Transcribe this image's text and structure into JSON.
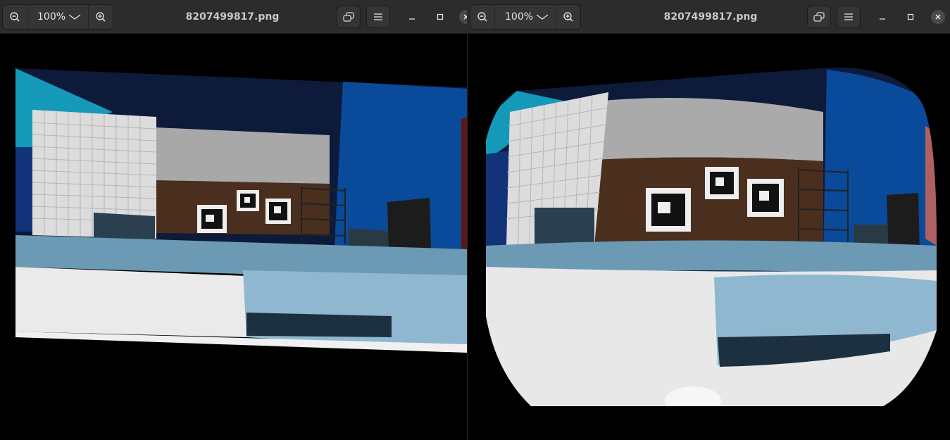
{
  "windows": [
    {
      "id": "left",
      "title": "8207499817.png",
      "zoom_level": "100%",
      "icons": {
        "zoom_out": "zoom-out-icon",
        "zoom_dropdown": "chevron-down-icon",
        "zoom_in": "zoom-in-icon",
        "fullscreen": "fullscreen-icon",
        "menu": "hamburger-menu-icon",
        "minimize": "minimize-icon",
        "maximize": "maximize-icon",
        "close": "close-icon"
      }
    },
    {
      "id": "right",
      "title": "8207499817.png",
      "zoom_level": "100%",
      "icons": {
        "zoom_out": "zoom-out-icon",
        "zoom_dropdown": "chevron-down-icon",
        "zoom_in": "zoom-in-icon",
        "fullscreen": "fullscreen-icon",
        "menu": "hamburger-menu-icon",
        "minimize": "minimize-icon",
        "maximize": "maximize-icon",
        "close": "close-icon"
      }
    }
  ],
  "colors": {
    "titlebar": "#2c2c2c",
    "button": "#353535",
    "title_text": "#c8c8c8",
    "viewer_background": "#000000"
  }
}
